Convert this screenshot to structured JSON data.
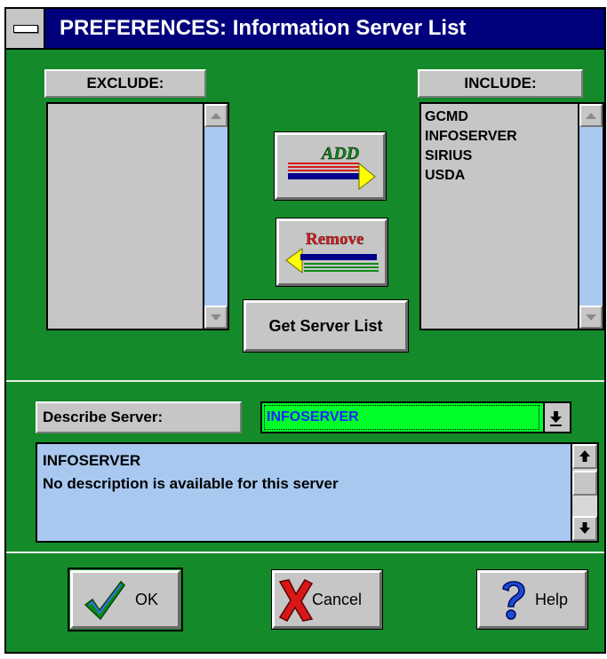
{
  "window": {
    "title": "PREFERENCES: Information Server List"
  },
  "exclude": {
    "label": "EXCLUDE:",
    "items": []
  },
  "include": {
    "label": "INCLUDE:",
    "items": [
      "GCMD",
      "INFOSERVER",
      "SIRIUS",
      "USDA"
    ]
  },
  "buttons": {
    "add_label": "ADD",
    "remove_label": "Remove",
    "get_server_list_label": "Get Server List",
    "ok_label": "OK",
    "cancel_label": "Cancel",
    "help_label": "Help"
  },
  "describe": {
    "label": "Describe Server:",
    "selected": "INFOSERVER",
    "description_lines": [
      "INFOSERVER",
      "No description is available for this server"
    ]
  },
  "colors": {
    "window_bg": "#158a2a",
    "title_bg": "#00007c",
    "combo_bg": "#00ff2a",
    "list_scroll": "#a8c8f0"
  }
}
